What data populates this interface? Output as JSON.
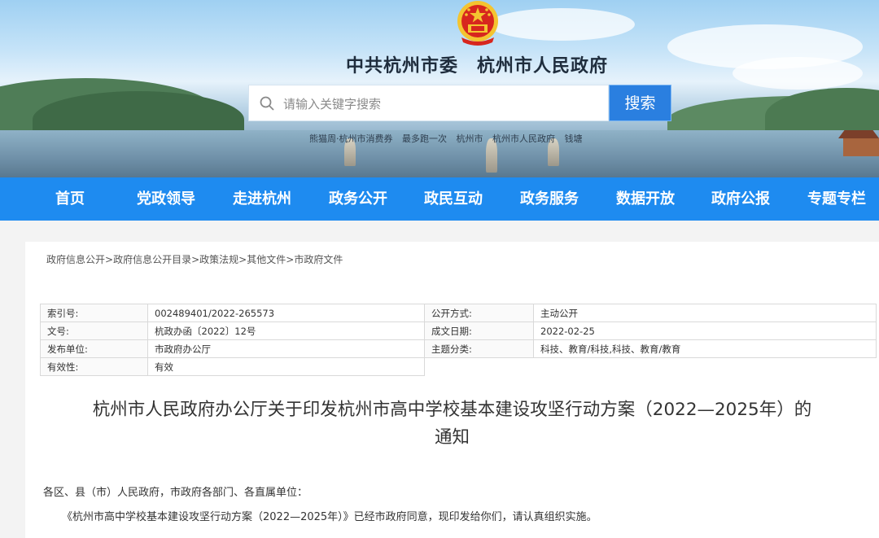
{
  "header": {
    "site_title": "中共杭州市委　杭州市人民政府",
    "emblem_icon": "national-emblem-icon",
    "search": {
      "placeholder": "请输入关键字搜索",
      "button_label": "搜索",
      "icon": "search-icon"
    },
    "hot_links": [
      "熊猫周·杭州市消费券",
      "最多跑一次",
      "杭州市",
      "杭州市人民政府",
      "钱塘"
    ]
  },
  "nav": {
    "items": [
      "首页",
      "党政领导",
      "走进杭州",
      "政务公开",
      "政民互动",
      "政务服务",
      "数据开放",
      "政府公报",
      "专题专栏"
    ]
  },
  "breadcrumb": [
    "政府信息公开",
    "政府信息公开目录",
    "政策法规",
    "其他文件",
    "市政府文件"
  ],
  "info_table": {
    "rows": [
      {
        "k1": "索引号:",
        "v1": "002489401/2022-265573",
        "k2": "公开方式:",
        "v2": "主动公开"
      },
      {
        "k1": "文号:",
        "v1": "杭政办函〔2022〕12号",
        "k2": "成文日期:",
        "v2": "2022-02-25"
      },
      {
        "k1": "发布单位:",
        "v1": "市政府办公厅",
        "k2": "主题分类:",
        "v2": "科技、教育/科技,科技、教育/教育"
      },
      {
        "k1": "有效性:",
        "v1": "有效"
      }
    ]
  },
  "document": {
    "title_line1": "杭州市人民政府办公厅关于印发杭州市高中学校基本建设攻坚行动方案（2022—2025年）的",
    "title_line2": "通知",
    "salutation": "各区、县（市）人民政府，市政府各部门、各直属单位：",
    "body": "《杭州市高中学校基本建设攻坚行动方案（2022—2025年）》已经市政府同意，现印发给你们，请认真组织实施。"
  },
  "colors": {
    "nav_bg": "#1e8bf0",
    "search_button": "#2a7fe0",
    "national_red": "#d7261e",
    "gold": "#f4c430"
  }
}
